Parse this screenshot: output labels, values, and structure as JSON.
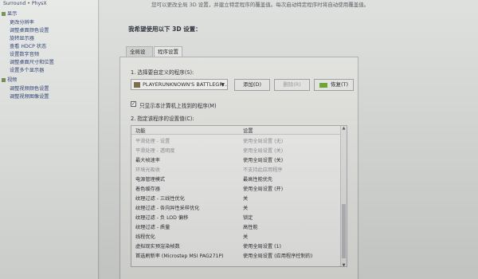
{
  "left_tree": {
    "header": "Surround • PhysX",
    "items": [
      {
        "label": "显示"
      },
      {
        "label": "更改分辨率"
      },
      {
        "label": "调整桌面颜色设置"
      },
      {
        "label": "旋转显示器"
      },
      {
        "label": "查看 HDCP 状态"
      },
      {
        "label": "设置数字音频"
      },
      {
        "label": "调整桌面尺寸和位置"
      },
      {
        "label": "设置多个显示器"
      },
      {
        "label": "视频"
      },
      {
        "label": "调整视频颜色设置"
      },
      {
        "label": "调整视频图像设置"
      }
    ]
  },
  "top_text": "您可以更改全局 3D 设置，并建立特定程序的覆盖值。每次启动特定程序时将自动使用覆盖值。",
  "heading": "我希望使用以下 3D 设置：",
  "tabs": [
    {
      "label": "全局设置"
    },
    {
      "label": "程序设置"
    }
  ],
  "program_section": {
    "label": "1. 选择要自定义的程序(S):",
    "selected_program": "PLAYERUNKNOWN'S BATTLEGR...",
    "buttons": {
      "add": "添加(D)",
      "remove": "删除(R)",
      "restore": "恢复(T)"
    }
  },
  "checkbox_label": "只显示本计算机上找到的程序(M)",
  "settings_section": {
    "label": "2. 指定该程序的设置值(C):",
    "columns": [
      "功能",
      "设置"
    ],
    "rows": [
      {
        "feature": "平滑处理 - 设置",
        "value": "使用全局设置 (无)",
        "dim": true
      },
      {
        "feature": "平滑处理 - 透明度",
        "value": "使用全局设置 (关)",
        "dim": true
      },
      {
        "feature": "最大帧速率",
        "value": "使用全局设置 (关)",
        "dim": false
      },
      {
        "feature": "环境光吸收",
        "value": "不支持此应用程序",
        "dim": true
      },
      {
        "feature": "电源管理模式",
        "value": "最高性能优先",
        "dim": false
      },
      {
        "feature": "着色缓存器",
        "value": "使用全局设置 (开)",
        "dim": false
      },
      {
        "feature": "纹理过滤 - 三线性优化",
        "value": "关",
        "dim": false
      },
      {
        "feature": "纹理过滤 - 各向异性采样优化",
        "value": "关",
        "dim": false
      },
      {
        "feature": "纹理过滤 - 负 LOD 偏移",
        "value": "锁定",
        "dim": false
      },
      {
        "feature": "纹理过滤 - 质量",
        "value": "高性能",
        "dim": false
      },
      {
        "feature": "线程优化",
        "value": "关",
        "dim": false
      },
      {
        "feature": "虚拟现实预渲染帧数",
        "value": "使用全局设置 (1)",
        "dim": false
      },
      {
        "feature": "首选刷新率 (Microstep MSI PAG271P)",
        "value": "使用全局设置 (应用程序控制的)",
        "dim": false
      }
    ]
  },
  "colors": {
    "accent": "#6aa72c",
    "link": "#253a70"
  }
}
